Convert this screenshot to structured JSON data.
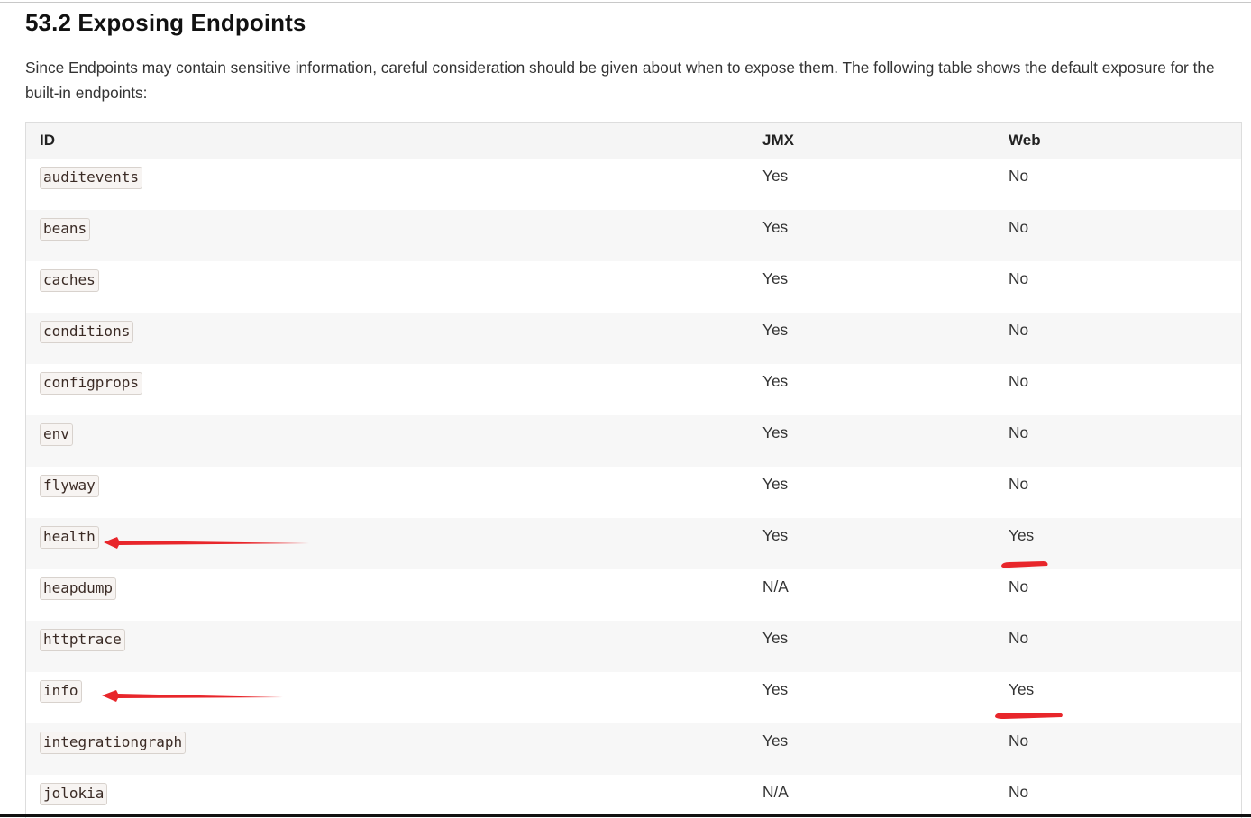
{
  "section": {
    "title": "53.2 Exposing Endpoints",
    "intro": "Since Endpoints may contain sensitive information, careful consideration should be given about when to expose them. The following table shows the default exposure for the built-in endpoints:"
  },
  "table": {
    "headers": [
      "ID",
      "JMX",
      "Web"
    ],
    "rows": [
      {
        "id": "auditevents",
        "jmx": "Yes",
        "web": "No"
      },
      {
        "id": "beans",
        "jmx": "Yes",
        "web": "No"
      },
      {
        "id": "caches",
        "jmx": "Yes",
        "web": "No"
      },
      {
        "id": "conditions",
        "jmx": "Yes",
        "web": "No"
      },
      {
        "id": "configprops",
        "jmx": "Yes",
        "web": "No"
      },
      {
        "id": "env",
        "jmx": "Yes",
        "web": "No"
      },
      {
        "id": "flyway",
        "jmx": "Yes",
        "web": "No"
      },
      {
        "id": "health",
        "jmx": "Yes",
        "web": "Yes"
      },
      {
        "id": "heapdump",
        "jmx": "N/A",
        "web": "No"
      },
      {
        "id": "httptrace",
        "jmx": "Yes",
        "web": "No"
      },
      {
        "id": "info",
        "jmx": "Yes",
        "web": "Yes"
      },
      {
        "id": "integrationgraph",
        "jmx": "Yes",
        "web": "No"
      },
      {
        "id": "jolokia",
        "jmx": "N/A",
        "web": "No"
      }
    ]
  },
  "annotations": {
    "color": "#e8262b",
    "arrows": [
      {
        "points_to": "health"
      },
      {
        "points_to": "info"
      }
    ],
    "underlines": [
      {
        "under": "health web Yes"
      },
      {
        "under": "info web Yes"
      }
    ]
  }
}
